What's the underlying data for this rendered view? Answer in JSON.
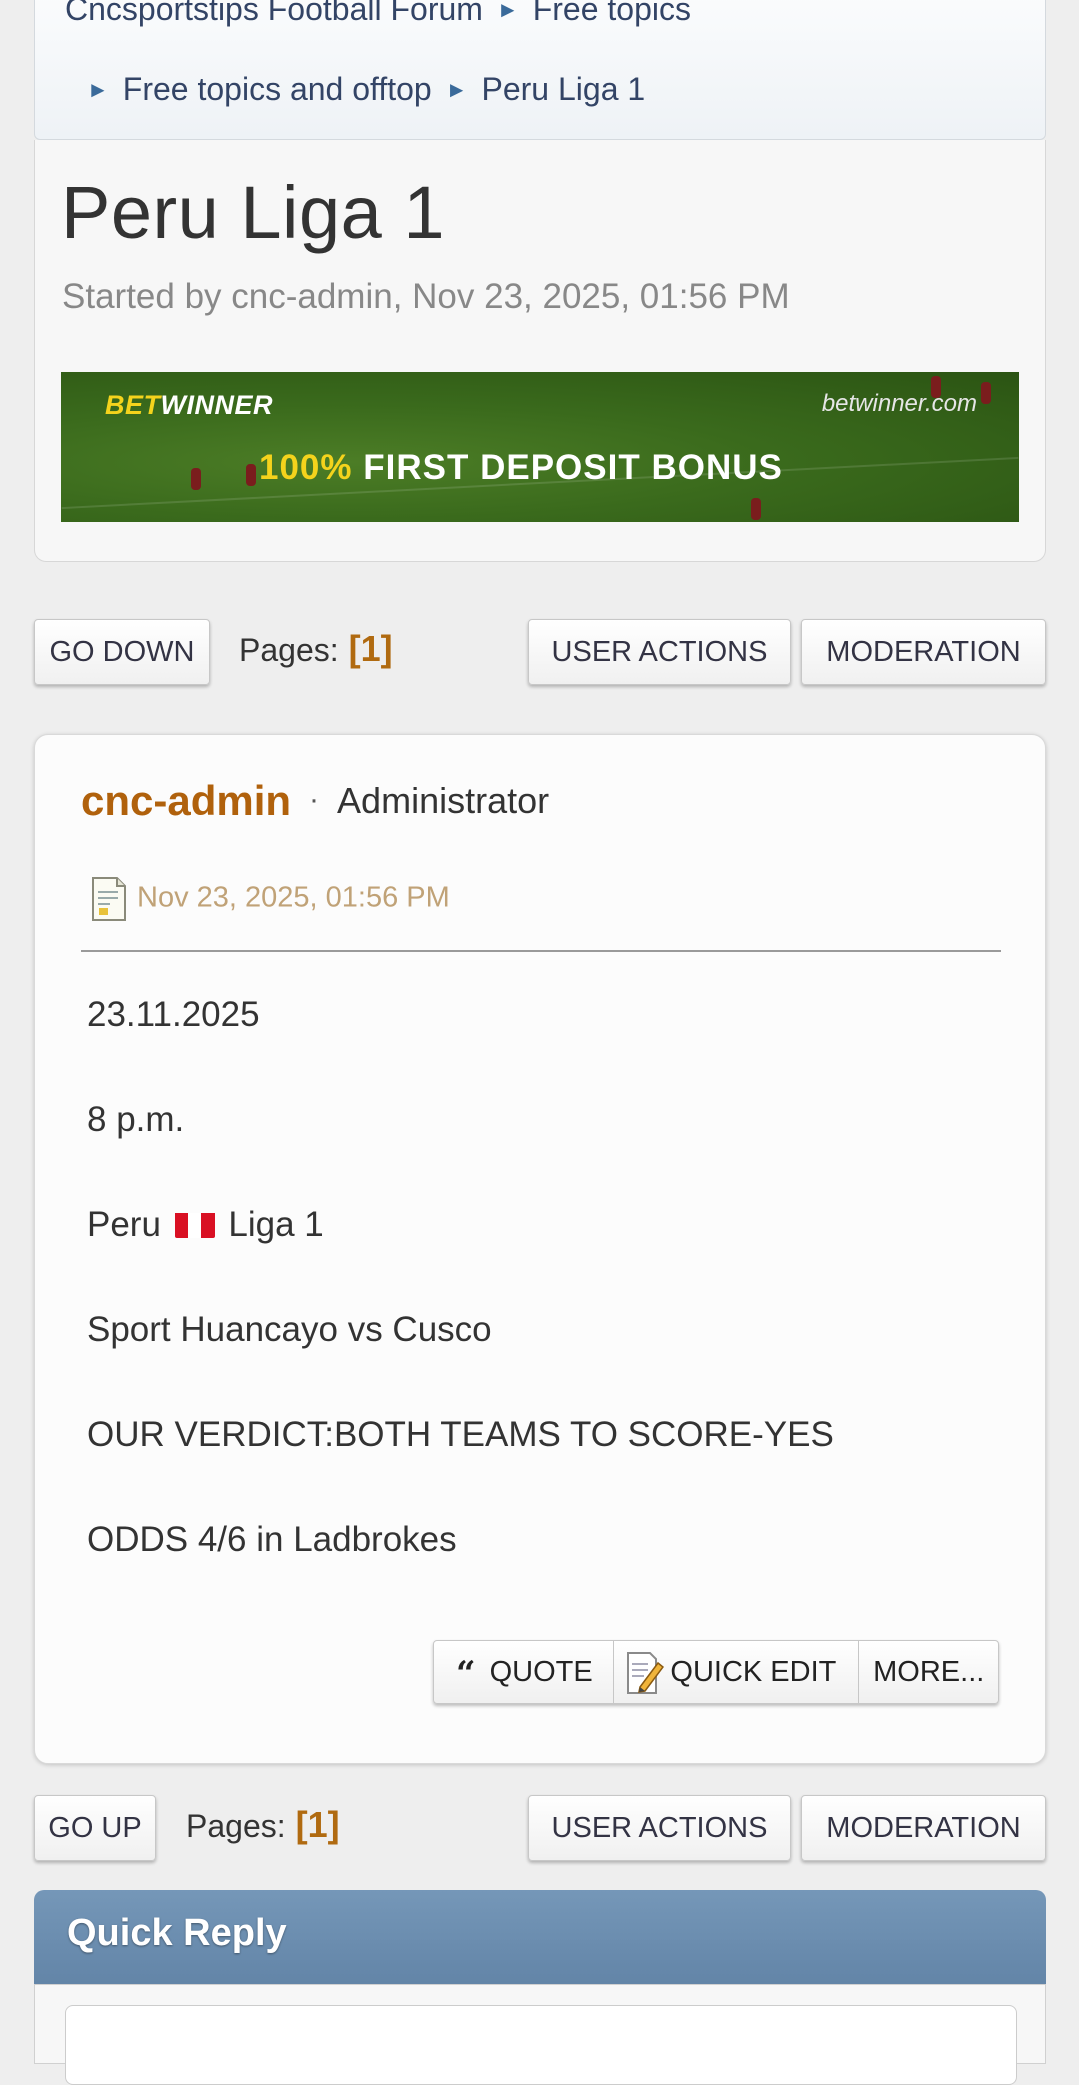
{
  "breadcrumb": {
    "items": [
      "Cncsportstips Football Forum",
      "Free topics",
      "Free topics and offtop",
      "Peru Liga 1"
    ],
    "separator": "►"
  },
  "topic": {
    "title": "Peru Liga 1",
    "started_by": "Started by cnc-admin, Nov 23, 2025, 01:56 PM"
  },
  "banner": {
    "logo_bet": "BET",
    "logo_winner": "WINNER",
    "site": "betwinner.com",
    "bonus_pct": "100%",
    "bonus_text": "FIRST DEPOSIT BONUS"
  },
  "top_bar": {
    "go_label": "GO DOWN",
    "pages_label": "Pages:",
    "page_num": "[1]",
    "user_actions": "USER ACTIONS",
    "moderation": "MODERATION"
  },
  "bottom_bar": {
    "go_label": "GO UP",
    "pages_label": "Pages:",
    "page_num": "[1]",
    "user_actions": "USER ACTIONS",
    "moderation": "MODERATION"
  },
  "post": {
    "author": "cnc-admin",
    "separator": "·",
    "role": "Administrator",
    "date": "Nov 23, 2025, 01:56 PM",
    "lines": {
      "l1": "23.11.2025",
      "l2": "8 p.m.",
      "l3a": "Peru",
      "l3b": "Liga 1",
      "l4": "Sport Huancayo vs Cusco",
      "l5": "OUR VERDICT:BOTH TEAMS TO SCORE-YES",
      "l6": "ODDS 4/6 in Ladbrokes"
    },
    "buttons": {
      "quote_glyph": "“",
      "quote": "QUOTE",
      "quick_edit": "QUICK EDIT",
      "more": "MORE..."
    }
  },
  "quick_reply": {
    "title": "Quick Reply"
  },
  "colors": {
    "accent_orange": "#b0610c",
    "quick_reply_header": "#6689ad",
    "peru_red": "#d91023"
  }
}
